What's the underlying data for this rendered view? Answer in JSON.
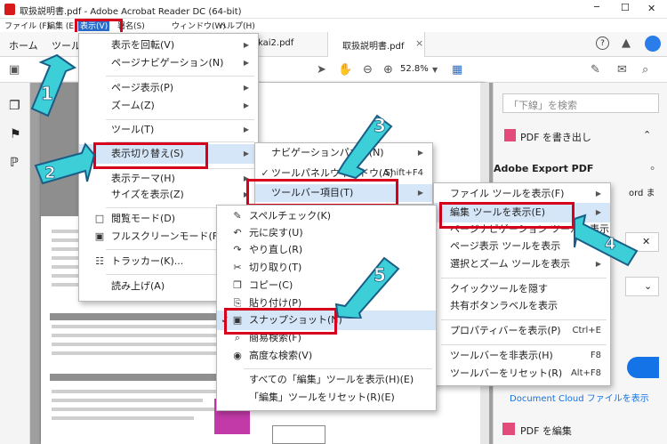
{
  "window": {
    "title": "取扱説明書.pdf - Adobe Acrobat Reader DC (64-bit)",
    "minimize": "─",
    "maximize": "☐",
    "close": "✕"
  },
  "menubar": {
    "file": "ファイル (F)",
    "edit": "編集 (E)",
    "view": "表示(V)",
    "sign": "署名(S)",
    "window": "ウィンドウ(W)",
    "help": "ヘルプ(H)"
  },
  "tabs": {
    "home": "ホーム",
    "tools": "ツール",
    "doc_other": "kai2.pdf",
    "doc_active": "取扱説明書.pdf",
    "close_x": "×"
  },
  "toolbar": {
    "zoom_value": "52.8%"
  },
  "view_menu": {
    "items": [
      {
        "label": "表示を回転(V)"
      },
      {
        "label": "ページナビゲーション(N)"
      },
      {
        "label": "ページ表示(P)"
      },
      {
        "label": "ズーム(Z)"
      },
      {
        "label": "ツール(T)"
      },
      {
        "label": "表示切り替え(S)"
      },
      {
        "label": "表示テーマ(H)"
      },
      {
        "label": "サイズを表示(Z)"
      },
      {
        "label": "閲覧モード(D)"
      },
      {
        "label": "フルスクリーンモード(F)"
      },
      {
        "label": "トラッカー(K)..."
      },
      {
        "label": "読み上げ(A)"
      }
    ]
  },
  "toggle_menu": {
    "items": [
      {
        "label": "ナビゲーションパネル(N)"
      },
      {
        "label": "ツールパネルウィンドウ(A)",
        "shortcut": "Shift+F4"
      },
      {
        "label": "ツールバー項目(T)"
      }
    ]
  },
  "toolbar_items_menu": {
    "items": [
      {
        "label": "ファイル ツールを表示(F)"
      },
      {
        "label": "編集 ツールを表示(E)"
      },
      {
        "label": "ページナビゲーション ツールを表示"
      },
      {
        "label": "ページ表示 ツールを表示"
      },
      {
        "label": "選択とズーム ツールを表示"
      },
      {
        "label": "クイックツールを隠す"
      },
      {
        "label": "共有ボタンラベルを表示"
      },
      {
        "label": "プロパティバーを表示(P)",
        "shortcut": "Ctrl+E"
      },
      {
        "label": "ツールバーを非表示(H)",
        "shortcut": "F8"
      },
      {
        "label": "ツールバーをリセット(R)",
        "shortcut": "Alt+F8"
      }
    ]
  },
  "edit_tools_menu": {
    "items": [
      {
        "label": "スペルチェック(K)"
      },
      {
        "label": "元に戻す(U)"
      },
      {
        "label": "やり直し(R)"
      },
      {
        "label": "切り取り(T)"
      },
      {
        "label": "コピー(C)"
      },
      {
        "label": "貼り付け(P)"
      },
      {
        "label": "スナップショット(N)"
      },
      {
        "label": "簡易検索(F)"
      },
      {
        "label": "高度な検索(V)"
      },
      {
        "label": "すべての「編集」ツールを表示(H)(E)"
      },
      {
        "label": "「編集」ツールをリセット(R)(E)"
      }
    ]
  },
  "right_panel": {
    "search_placeholder": "「下線」を検索",
    "export_header": "PDF を書き出し",
    "export_title": "Adobe Export PDF",
    "word_frag": "ord ま",
    "doc_cloud": "Document Cloud ファイルを表示",
    "edit_pdf": "PDF を編集"
  },
  "steps": [
    "1",
    "2",
    "3",
    "4",
    "5"
  ],
  "colors": {
    "highlight_red": "#d6001c",
    "arrow_cyan": "#3ccfd8",
    "menu_hover": "#d5e6f8",
    "accent_blue": "#1473e6"
  }
}
